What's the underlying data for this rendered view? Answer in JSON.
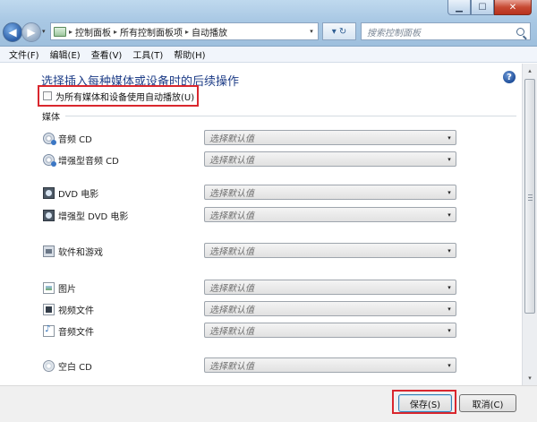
{
  "window": {
    "caption_buttons": {
      "minimize": "▁",
      "maximize": "☐",
      "close": "✕"
    }
  },
  "navigation": {
    "back": "◀",
    "forward": "▶",
    "history_dropdown": "▾",
    "breadcrumbs": [
      "控制面板",
      "所有控制面板项",
      "自动播放"
    ],
    "separator": "▸",
    "address_dropdown": "▾",
    "refresh_symbols": {
      "dropdown": "▾",
      "refresh": "↻"
    },
    "search_placeholder": "搜索控制面板"
  },
  "menu": [
    "文件(F)",
    "编辑(E)",
    "查看(V)",
    "工具(T)",
    "帮助(H)"
  ],
  "content": {
    "heading": "选择插入每种媒体或设备时的后续操作",
    "help": "?",
    "global_checkbox": {
      "label": "为所有媒体和设备使用自动播放(U)",
      "checked": false
    },
    "section_title": "媒体",
    "default_option": "选择默认值",
    "caret": "▾",
    "media_rows": [
      {
        "label": "音频 CD",
        "icon": "audio-cd-icon"
      },
      {
        "label": "增强型音频 CD",
        "icon": "enhanced-audio-cd-icon"
      },
      {
        "label": "DVD 电影",
        "icon": "dvd-movie-icon"
      },
      {
        "label": "增强型 DVD 电影",
        "icon": "enhanced-dvd-movie-icon"
      },
      {
        "label": "软件和游戏",
        "icon": "software-games-icon"
      },
      {
        "label": "图片",
        "icon": "picture-icon"
      },
      {
        "label": "视频文件",
        "icon": "video-file-icon"
      },
      {
        "label": "音频文件",
        "icon": "audio-file-icon"
      },
      {
        "label": "空白 CD",
        "icon": "blank-cd-icon"
      }
    ]
  },
  "scrollbar": {
    "up": "▴",
    "down": "▾"
  },
  "buttons": {
    "save": "保存(S)",
    "cancel": "取消(C)"
  },
  "colors": {
    "heading": "#1e3d87",
    "highlight_box": "#d9272e",
    "titlebar": "#a9c8e4"
  }
}
